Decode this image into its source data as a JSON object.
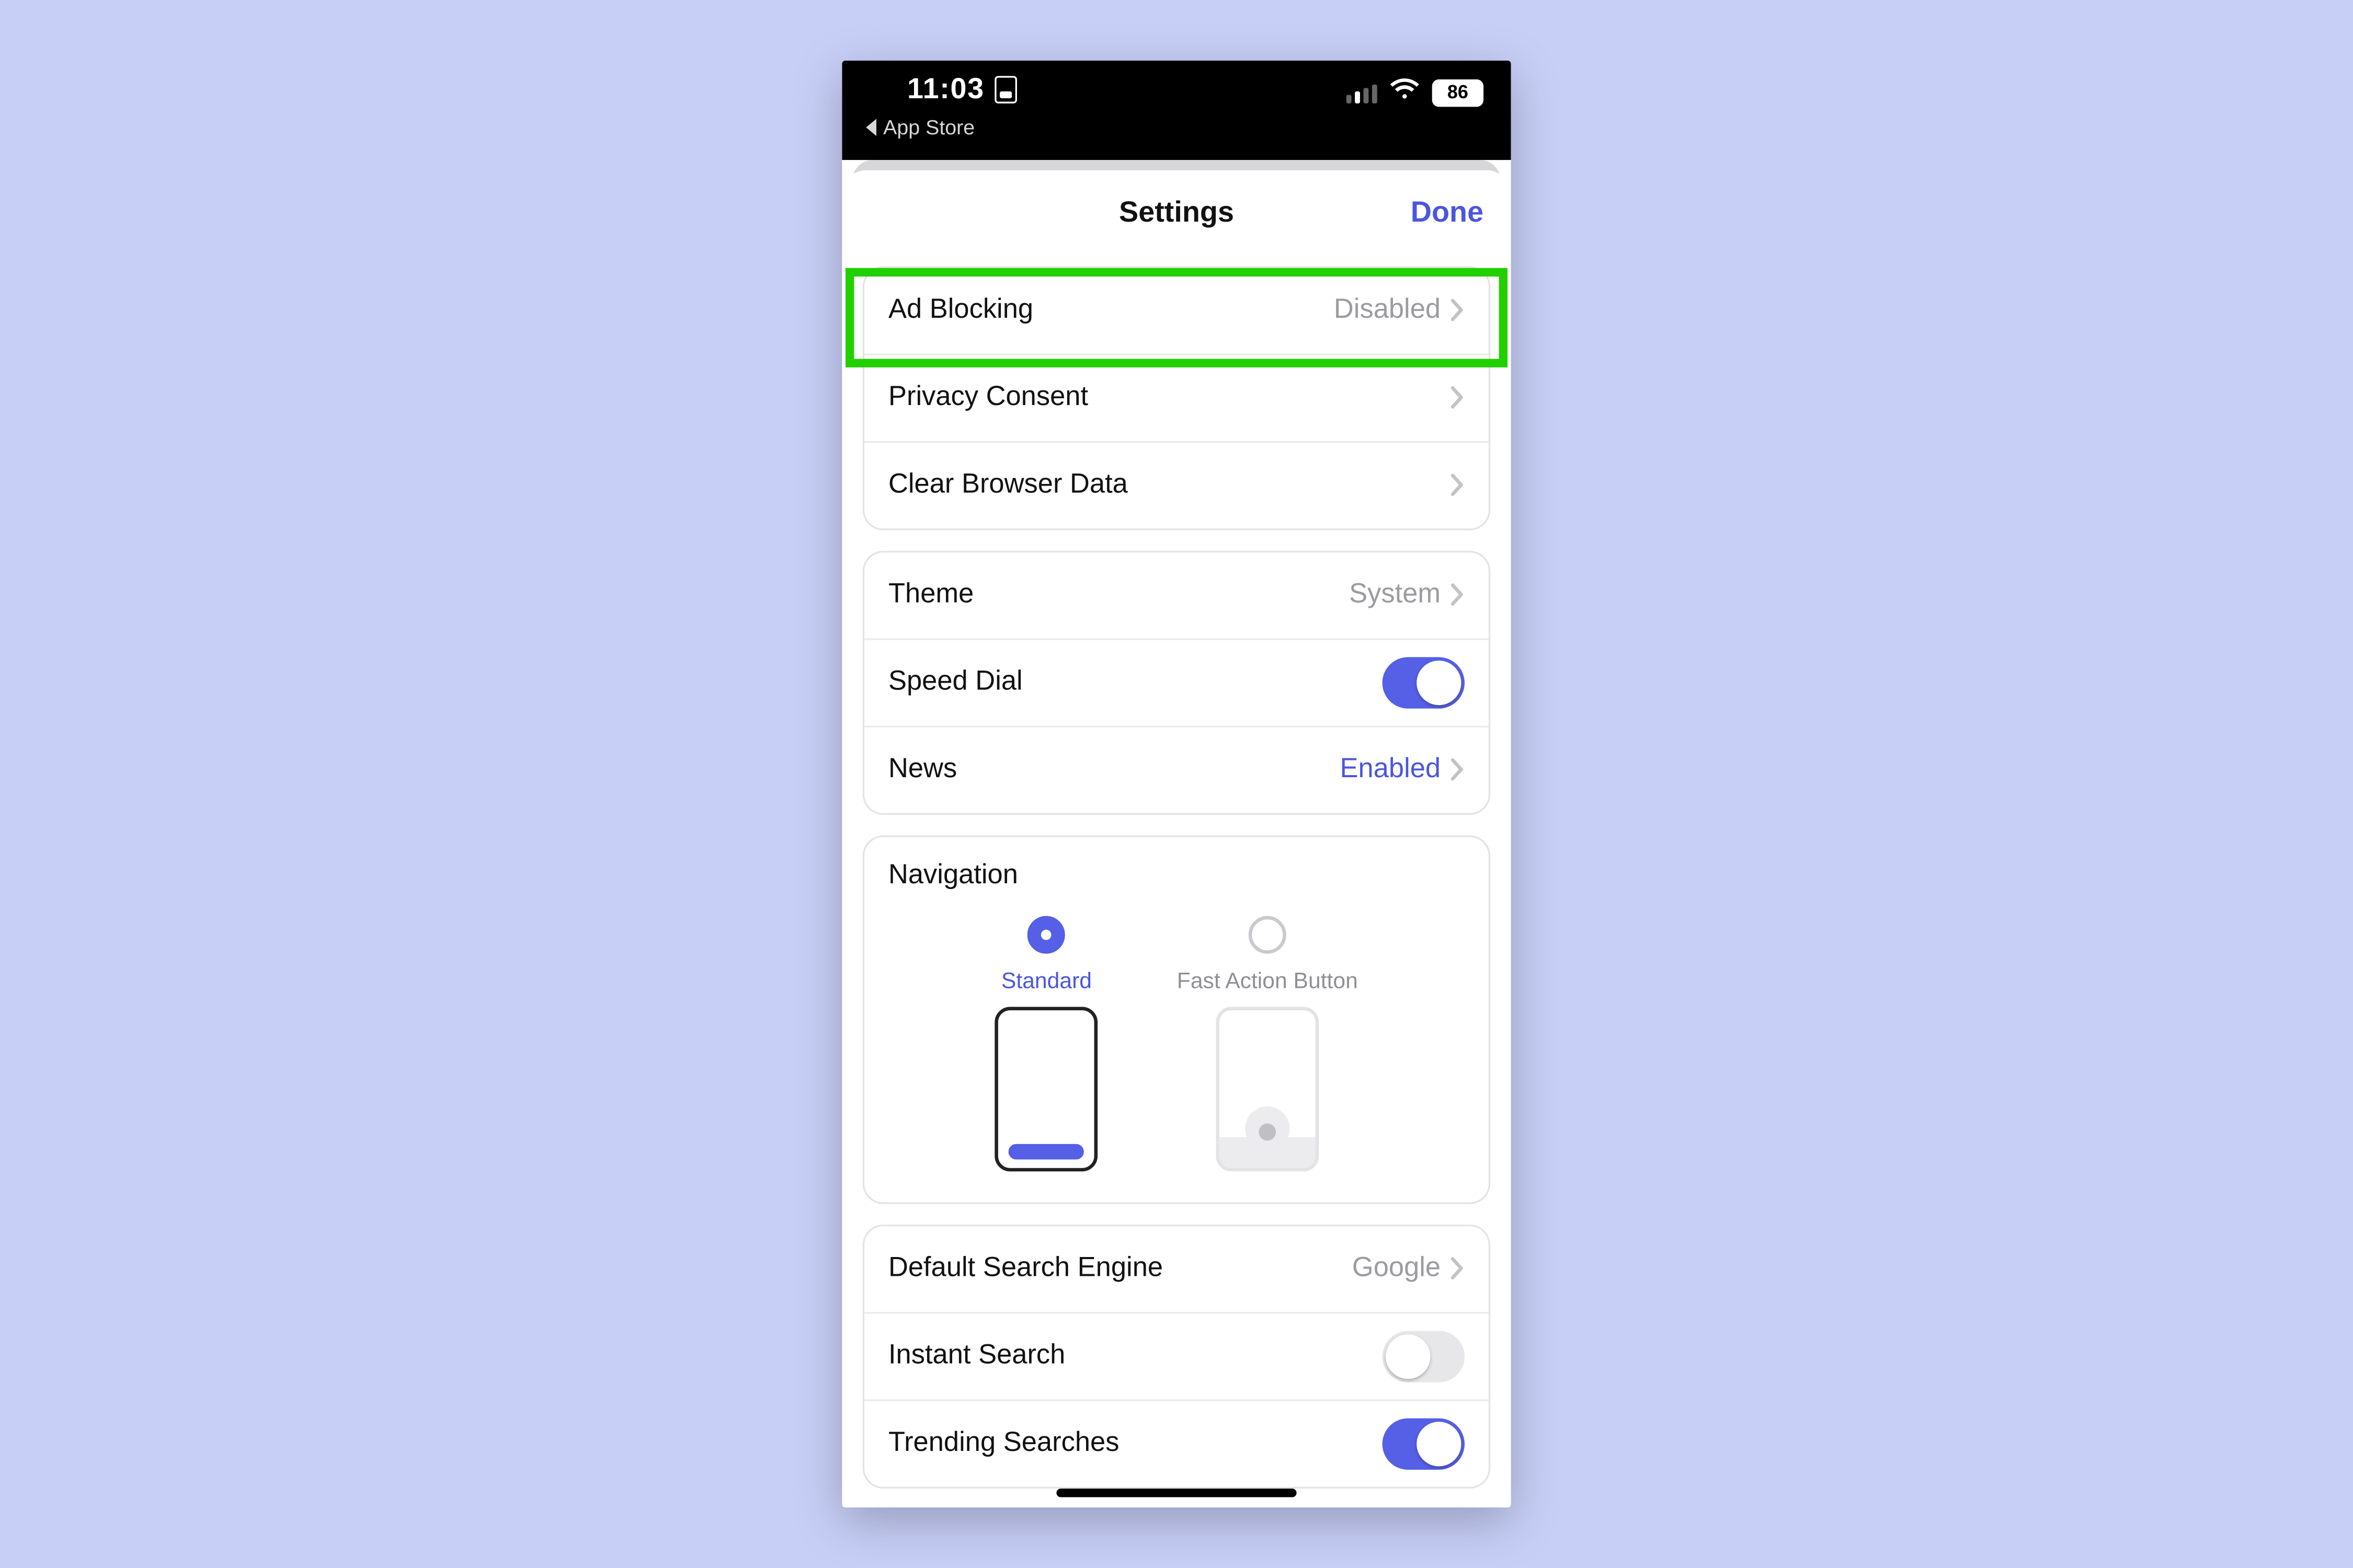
{
  "status": {
    "time": "11:03",
    "back_app": "App Store",
    "battery": "86"
  },
  "nav": {
    "title": "Settings",
    "done": "Done"
  },
  "group1": {
    "ad_blocking": {
      "label": "Ad Blocking",
      "value": "Disabled"
    },
    "privacy_consent": {
      "label": "Privacy Consent"
    },
    "clear_data": {
      "label": "Clear Browser Data"
    }
  },
  "group2": {
    "theme": {
      "label": "Theme",
      "value": "System"
    },
    "speed_dial": {
      "label": "Speed Dial"
    },
    "news": {
      "label": "News",
      "value": "Enabled"
    }
  },
  "navigation": {
    "header": "Navigation",
    "standard": "Standard",
    "fab": "Fast Action Button"
  },
  "group3": {
    "search_engine": {
      "label": "Default Search Engine",
      "value": "Google"
    },
    "instant_search": {
      "label": "Instant Search"
    },
    "trending": {
      "label": "Trending Searches"
    }
  }
}
